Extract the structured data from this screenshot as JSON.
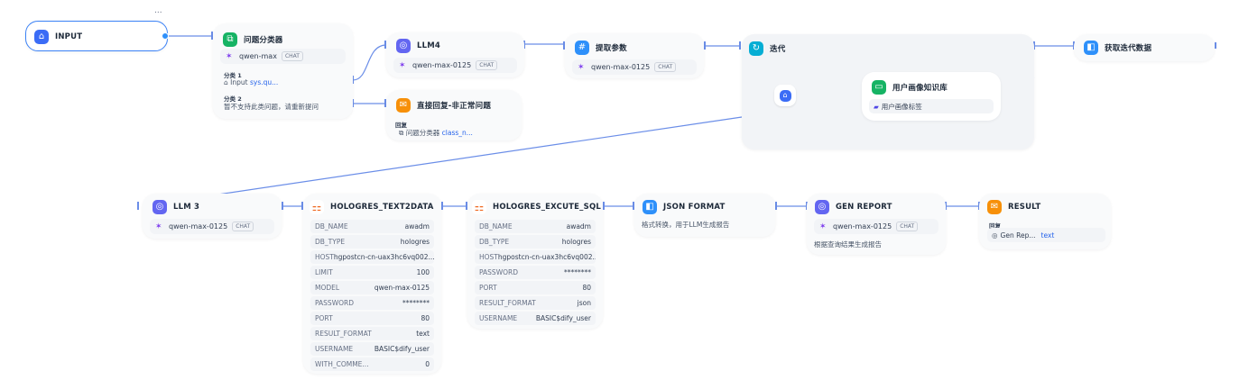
{
  "more_menu": "...",
  "input_node": {
    "title": "INPUT"
  },
  "classifier": {
    "title": "问题分类器",
    "model": "qwen-max",
    "chat": "CHAT",
    "class1_label": "分类 1",
    "class1_source": "Input",
    "class1_var": "sys.qu...",
    "class2_label": "分类 2",
    "class2_text": "暂不支持此类问题，请重新提问"
  },
  "llm4": {
    "title": "LLM4",
    "model": "qwen-max-0125",
    "chat": "CHAT"
  },
  "direct_reply": {
    "title": "直接回复-非正常问题",
    "label": "回复",
    "source": "问题分类器",
    "var": "class_n..."
  },
  "extract_params": {
    "title": "提取参数",
    "model": "qwen-max-0125",
    "chat": "CHAT"
  },
  "iteration": {
    "title": "迭代"
  },
  "knowledge": {
    "title": "用户画像知识库",
    "item": "用户画像标签"
  },
  "get_iter": {
    "title": "获取迭代数据"
  },
  "llm3": {
    "title": "LLM 3",
    "model": "qwen-max-0125",
    "chat": "CHAT"
  },
  "text2data": {
    "title": "HOLOGRES_TEXT2DATA",
    "params": [
      {
        "k": "DB_NAME",
        "v": "awadm"
      },
      {
        "k": "DB_TYPE",
        "v": "hologres"
      },
      {
        "k": "HOST",
        "v": "hgpostcn-cn-uax3hc6vq002..."
      },
      {
        "k": "LIMIT",
        "v": "100"
      },
      {
        "k": "MODEL",
        "v": "qwen-max-0125"
      },
      {
        "k": "PASSWORD",
        "v": "********"
      },
      {
        "k": "PORT",
        "v": "80"
      },
      {
        "k": "RESULT_FORMAT",
        "v": "text"
      },
      {
        "k": "USERNAME",
        "v": "BASIC$dify_user"
      },
      {
        "k": "WITH_COMME...",
        "v": "0"
      }
    ]
  },
  "excute_sql": {
    "title": "HOLOGRES_EXCUTE_SQL",
    "params": [
      {
        "k": "DB_NAME",
        "v": "awadm"
      },
      {
        "k": "DB_TYPE",
        "v": "hologres"
      },
      {
        "k": "HOST",
        "v": "hgpostcn-cn-uax3hc6vq002..."
      },
      {
        "k": "PASSWORD",
        "v": "********"
      },
      {
        "k": "PORT",
        "v": "80"
      },
      {
        "k": "RESULT_FORMAT",
        "v": "json"
      },
      {
        "k": "USERNAME",
        "v": "BASIC$dify_user"
      }
    ]
  },
  "json_format": {
    "title": "JSON FORMAT",
    "desc": "格式转换，用于LLM生成报告"
  },
  "gen_report": {
    "title": "GEN REPORT",
    "model": "qwen-max-0125",
    "chat": "CHAT",
    "desc": "根据查询结果生成报告"
  },
  "result": {
    "title": "RESULT",
    "label": "回复",
    "source": "Gen Rep...",
    "var": "text"
  },
  "colors": {
    "accent": "#3b82f6",
    "edge": "#5b7fd6"
  }
}
